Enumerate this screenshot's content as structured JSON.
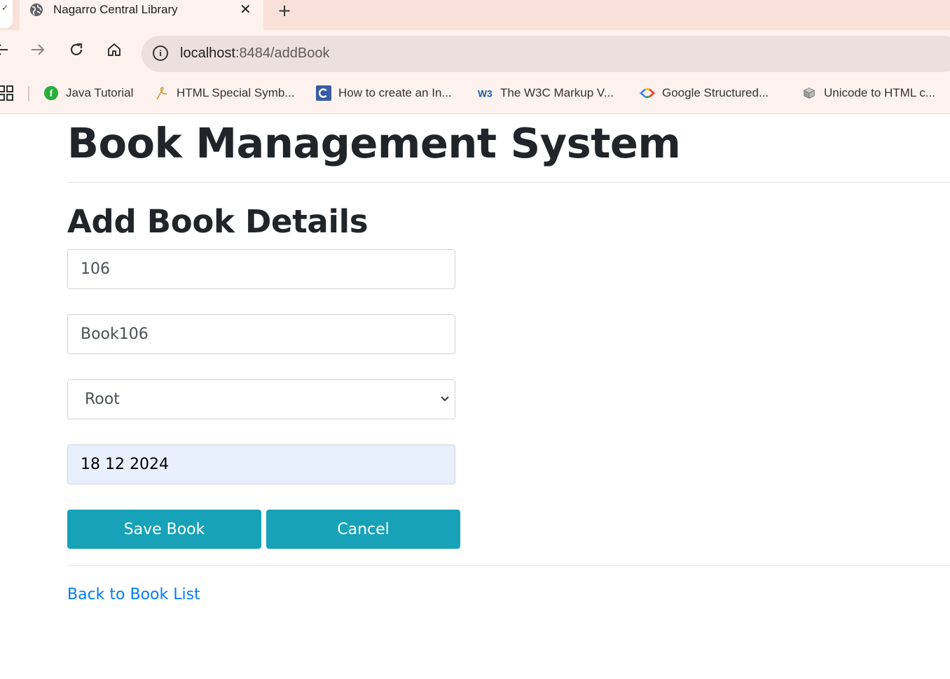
{
  "browser": {
    "tab": {
      "title": "Nagarro Central Library"
    },
    "address": {
      "host": "localhost",
      "path": ":8484/addBook"
    },
    "bookmarks": [
      {
        "label": "Java Tutorial",
        "icon": "java-tutorial-icon"
      },
      {
        "label": "HTML Special Symb...",
        "icon": "symbol-icon"
      },
      {
        "label": "How to create an In...",
        "icon": "c-logo-icon"
      },
      {
        "label": "The W3C Markup V...",
        "icon": "w3c-icon"
      },
      {
        "label": "Google Structured...",
        "icon": "google-code-icon"
      },
      {
        "label": "Unicode to HTML c...",
        "icon": "box-icon"
      }
    ]
  },
  "page": {
    "title": "Book Management System",
    "heading": "Add Book Details",
    "form": {
      "book_id": "106",
      "book_name": "Book106",
      "author_selected": "Root",
      "date": "18 12 2024",
      "save_label": "Save Book",
      "cancel_label": "Cancel"
    },
    "back_link": "Back to Book List"
  },
  "colors": {
    "button": "#17a2b8",
    "link": "#007bff",
    "tabstrip": "#f9e1da"
  }
}
